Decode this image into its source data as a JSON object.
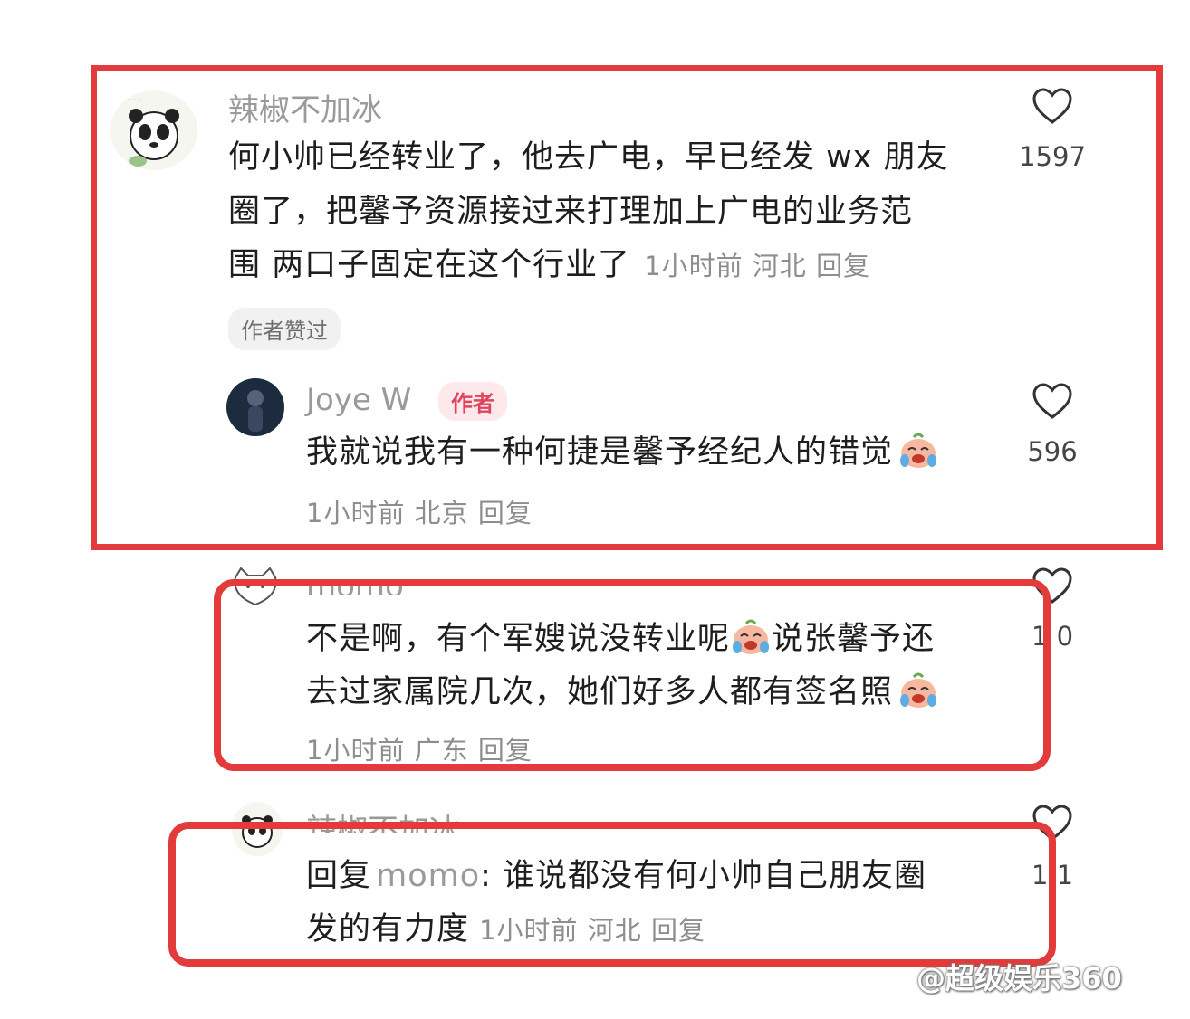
{
  "colors": {
    "frame_red": "#e33b3b",
    "author_tag": "#e0455e",
    "meta_gray": "#8e8e8e"
  },
  "comments": [
    {
      "user": "辣椒不加冰",
      "text": "何小帅已经转业了，他去广电，早已经发wx朋友圈了，把馨予资源接过来打理加上广电的业务范围 两口子固定在这个行业了",
      "line1": "何小帅已经转业了，他去广电，早已经发 wx 朋友",
      "line2": "圈了，把馨予资源接过来打理加上广电的业务范",
      "line3": "围 两口子固定在这个行业了",
      "meta": "1小时前 河北 回复",
      "likes": "1597",
      "badge": "作者赞过",
      "avatar_icon": "panda-avatar-icon"
    },
    {
      "user": "Joye W",
      "tag": "作者",
      "text": "我就说我有一种何捷是馨予经纪人的错觉",
      "meta": "1小时前 北京 回复",
      "likes": "596",
      "emoji_icon": "crying-laughing-emoji-icon"
    },
    {
      "user": "momo",
      "line1": "不是啊，有个军嫂说没转业呢",
      "line1b": "说张馨予还",
      "line2": "去过家属院几次，她们好多人都有签名照",
      "meta": "1小时前 广东 回复",
      "likes": "1 0"
    },
    {
      "user": "辣椒不加冰",
      "reply_prefix": "回复",
      "reply_to": "momo",
      "line1": ": 谁说都没有何小帅自己朋友圈",
      "line2": "发的有力度",
      "meta": "1小时前 河北 回复",
      "likes": "1 1"
    }
  ],
  "watermark": "@超级娱乐360"
}
